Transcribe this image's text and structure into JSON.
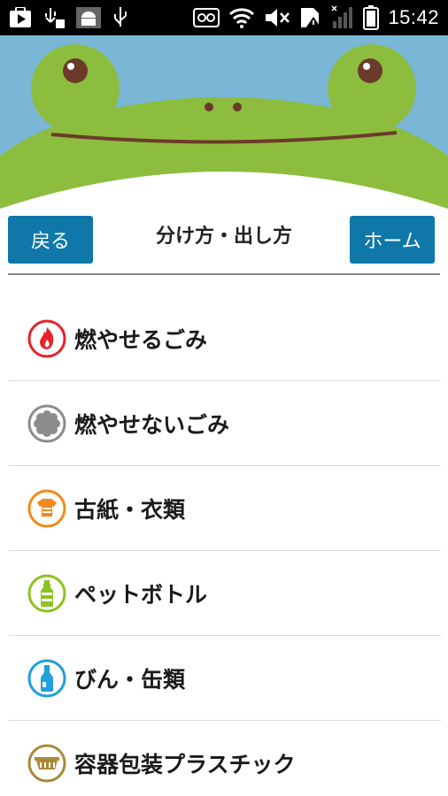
{
  "status_bar": {
    "time": "15:42",
    "left_icons": [
      "play-store-icon",
      "usb-debug-icon",
      "android-icon",
      "usb-icon"
    ],
    "right_icons": [
      "voicemail-icon",
      "wifi-icon",
      "mute-icon",
      "sim-alert-icon",
      "signal-icon",
      "battery-icon"
    ]
  },
  "header": {
    "back_label": "戻る",
    "title": "分け方・出し方",
    "home_label": "ホーム"
  },
  "categories": [
    {
      "label": "燃やせるごみ",
      "icon": "flame-icon",
      "color": "#e3242b"
    },
    {
      "label": "燃やせないごみ",
      "icon": "non-burnable-icon",
      "color": "#8c8c8c"
    },
    {
      "label": "古紙・衣類",
      "icon": "paper-clothes-icon",
      "color": "#f08a1c"
    },
    {
      "label": "ペットボトル",
      "icon": "pet-bottle-icon",
      "color": "#8dc21f"
    },
    {
      "label": "びん・缶類",
      "icon": "bottle-can-icon",
      "color": "#1ea0dc"
    },
    {
      "label": "容器包装プラスチック",
      "icon": "plastic-container-icon",
      "color": "#a88a3a"
    }
  ],
  "colors": {
    "accent": "#0f78a8",
    "frog_green": "#8cbd3f",
    "sky": "#7ab6d6"
  }
}
